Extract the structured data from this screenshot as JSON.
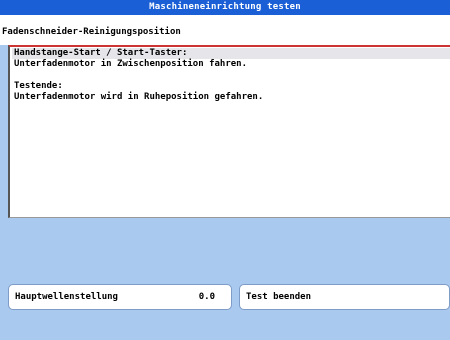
{
  "window": {
    "title": "Maschineneinrichtung testen"
  },
  "header": {
    "label": "Fadenschneider-Reinigungsposition"
  },
  "instructions": {
    "lines": [
      "Handstange-Start / Start-Taster:",
      "Unterfadenmotor in Zwischenposition fahren.",
      "",
      "Testende:",
      "Unterfadenmotor wird in Ruheposition gefahren."
    ]
  },
  "main_shaft": {
    "label": "Hauptwellenstellung",
    "value": "0.0"
  },
  "end_test": {
    "label": "Test beenden"
  },
  "colors": {
    "background": "#a9c9ef",
    "titlebar": "#1a5fd6",
    "accent_line": "#cc3333"
  }
}
